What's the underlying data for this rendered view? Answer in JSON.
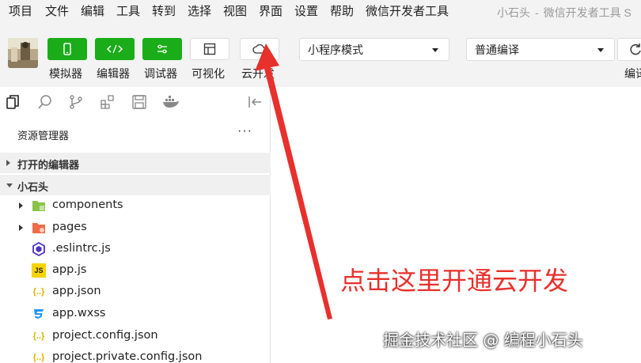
{
  "menu": {
    "items": [
      "项目",
      "文件",
      "编辑",
      "工具",
      "转到",
      "选择",
      "视图",
      "界面",
      "设置",
      "帮助",
      "微信开发者工具"
    ],
    "window_title_project": "小石头",
    "window_title_sep": "-",
    "window_title_app": "微信开发者工具 S"
  },
  "toolbar": {
    "buttons": [
      {
        "label": "模拟器",
        "icon": "phone-icon"
      },
      {
        "label": "编辑器",
        "icon": "code-icon"
      },
      {
        "label": "调试器",
        "icon": "debug-icon"
      },
      {
        "label": "可视化",
        "icon": "layout-icon"
      },
      {
        "label": "云开发",
        "icon": "cloud-icon"
      }
    ],
    "mode_select": "小程序模式",
    "compile_select": "普通编译",
    "compile_label": "编译",
    "accent_color": "#1aad19"
  },
  "sidebar": {
    "panel_title": "资源管理器",
    "more": "···",
    "open_editors": "打开的编辑器",
    "project_name": "小石头",
    "files": [
      {
        "name": "components",
        "icon": "folder-components-icon"
      },
      {
        "name": "pages",
        "icon": "folder-pages-icon"
      },
      {
        "name": ".eslintrc.js",
        "icon": "eslint-icon"
      },
      {
        "name": "app.js",
        "icon": "js-icon",
        "badge": "JS"
      },
      {
        "name": "app.json",
        "icon": "json-icon",
        "badge": "{..}"
      },
      {
        "name": "app.wxss",
        "icon": "css-icon"
      },
      {
        "name": "project.config.json",
        "icon": "json-icon",
        "badge": "{..}"
      },
      {
        "name": "project.private.config.json",
        "icon": "json-icon",
        "badge": "{..}"
      }
    ]
  },
  "annotation": {
    "text": "点击这里开通云开发",
    "color": "#e8302c"
  },
  "watermark": "掘金技术社区 @ 编程小石头"
}
